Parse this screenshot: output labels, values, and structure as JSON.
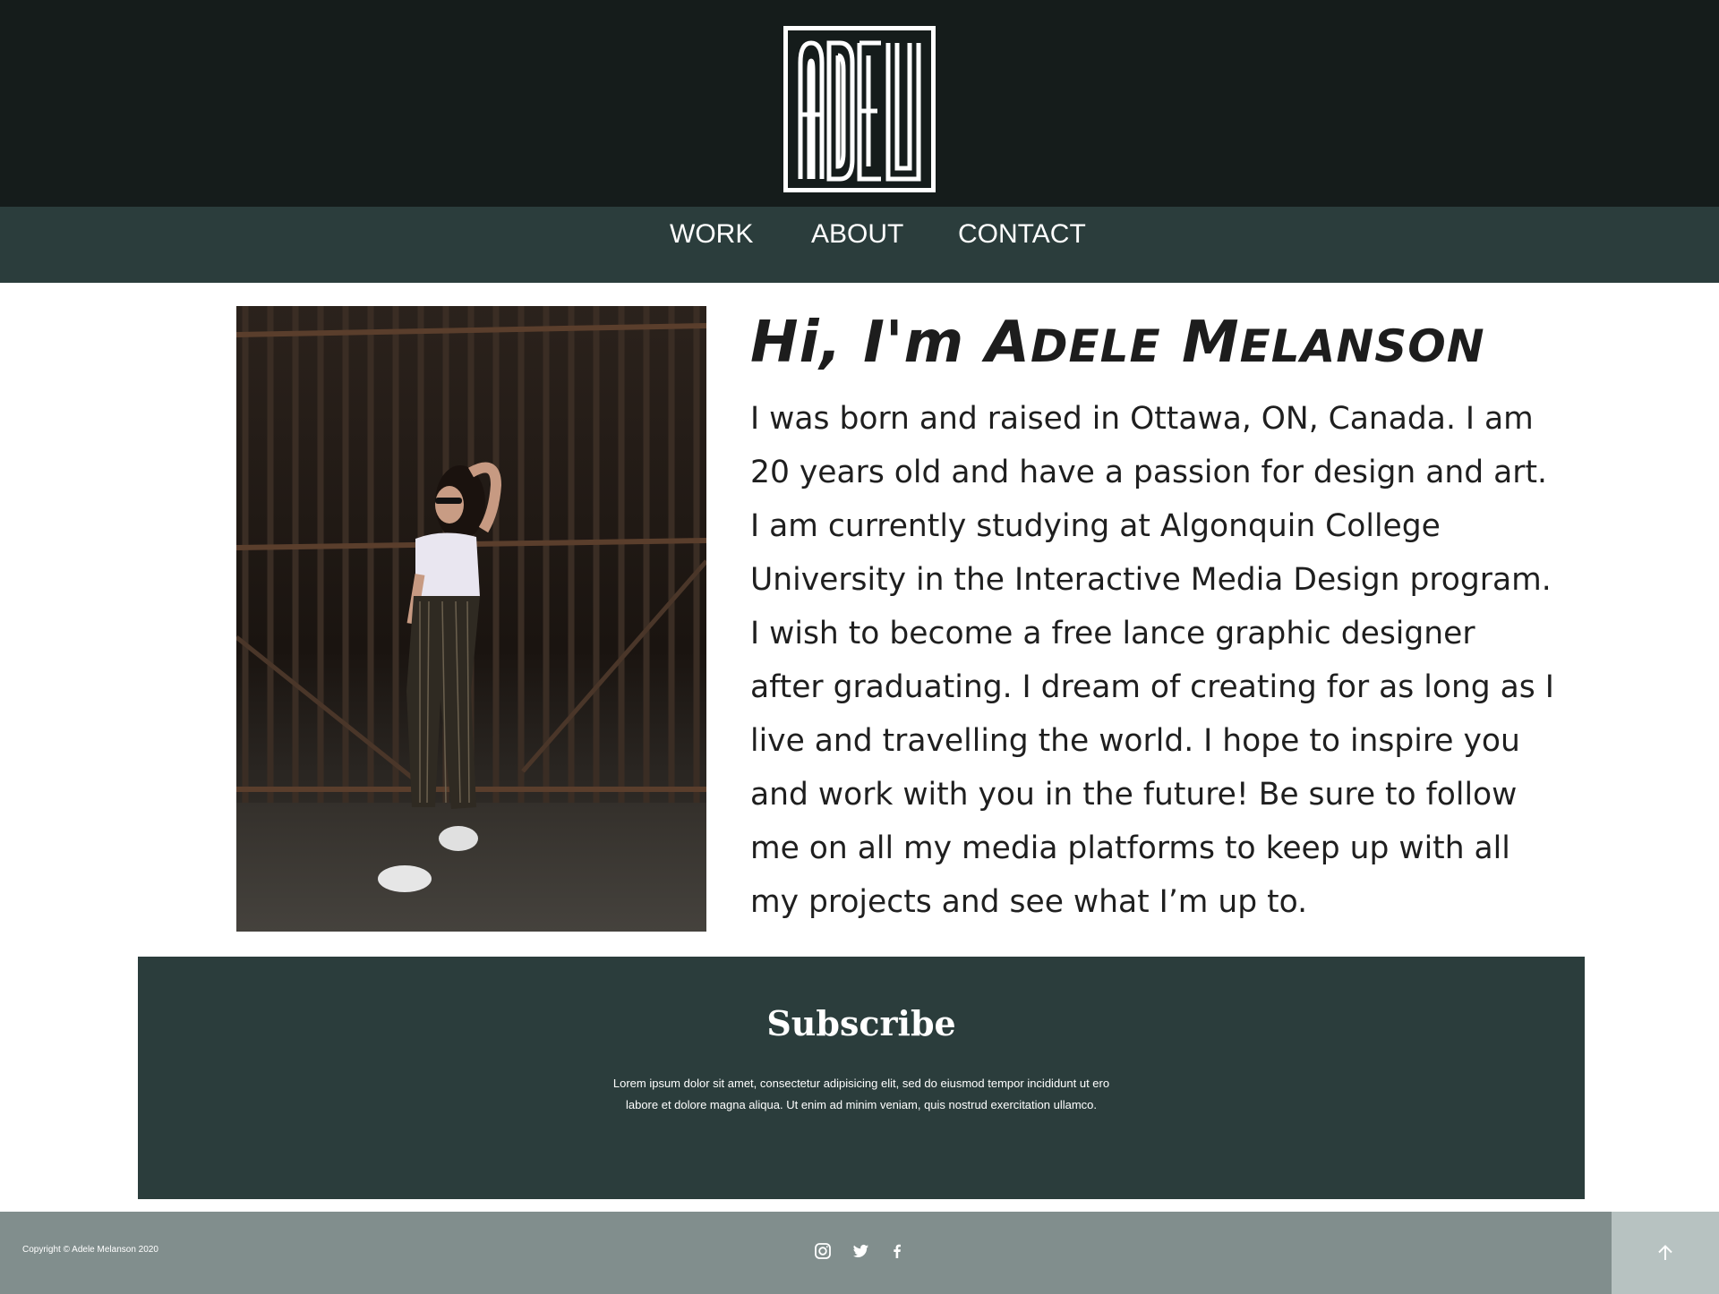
{
  "header": {
    "logo_text": "ADELE"
  },
  "nav": {
    "items": [
      {
        "label": "WORK"
      },
      {
        "label": "ABOUT"
      },
      {
        "label": "CONTACT"
      }
    ]
  },
  "about": {
    "title_hi": "Hi, I'm ",
    "title_name_first_initial": "A",
    "title_name_first_rest": "DELE",
    "title_name_last_initial": "M",
    "title_name_last_rest": "ELANSON",
    "bio_lines": [
      "I was born and raised in Ottawa, ON, Canada. I am",
      "20 years old and have a passion for design and art.",
      "I am currently studying at Algonquin College",
      "University in the Interactive Media Design program.",
      "I wish to become a free lance graphic designer",
      "after graduating. I dream of creating for as long as I",
      "live and travelling the world. I hope to inspire you",
      "and work with you in the future! Be sure to follow",
      "me on all my media platforms to keep up with all",
      "my projects and see what I’m up to."
    ]
  },
  "subscribe": {
    "title": "Subscribe",
    "text": "Lorem ipsum dolor sit amet, consectetur adipisicing elit, sed do eiusmod tempor incididunt ut ero labore et dolore magna aliqua. Ut enim ad minim veniam, quis nostrud exercitation ullamco."
  },
  "footer": {
    "copyright": "Copyright © Adele Melanson 2020",
    "social_icons": [
      "instagram-icon",
      "twitter-icon",
      "facebook-icon"
    ],
    "back_to_top_icon": "arrow-up-icon"
  },
  "colors": {
    "header_bg": "#151c1b",
    "nav_bg": "#2b3d3c",
    "subscribe_bg": "#2b3d3c",
    "footer_bg": "#818e8d",
    "back_to_top_bg": "#b7c2c1"
  }
}
